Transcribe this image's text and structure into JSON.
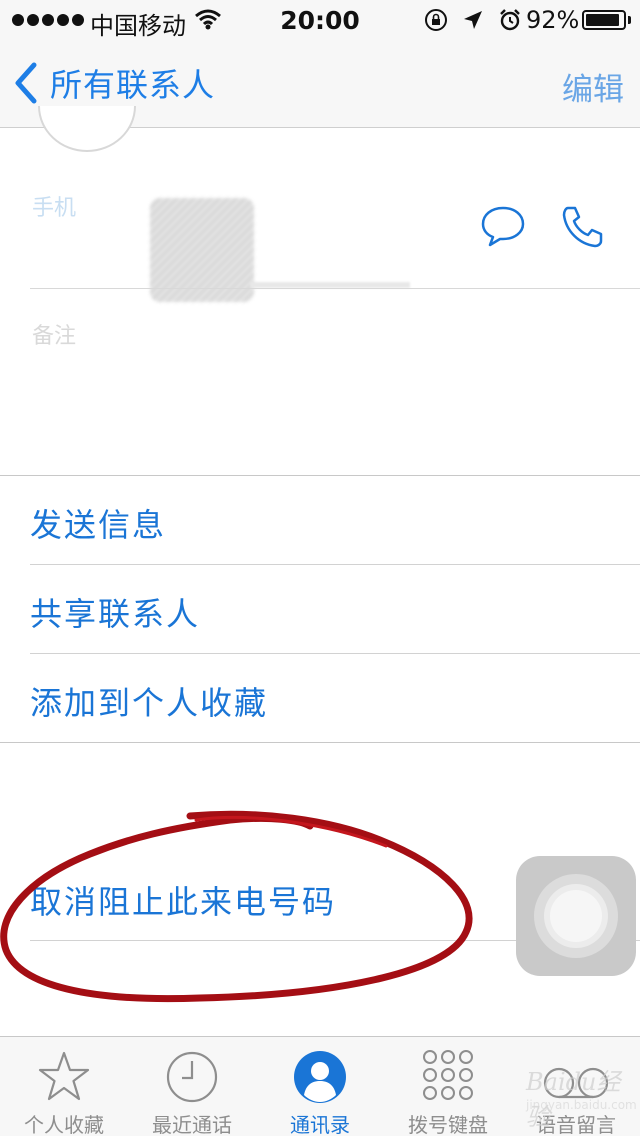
{
  "status_bar": {
    "carrier": "中国移动",
    "time": "20:00",
    "battery_percent": "92%",
    "battery_level": 0.92,
    "icons": [
      "signal-dots",
      "wifi-icon",
      "orientation-lock-icon",
      "location-icon",
      "alarm-icon",
      "battery-icon"
    ]
  },
  "nav": {
    "back_label": "所有联系人",
    "edit_label": "编辑"
  },
  "contact": {
    "mobile_label": "手机",
    "notes_label": "备注"
  },
  "actions": [
    {
      "label": "发送信息"
    },
    {
      "label": "共享联系人"
    },
    {
      "label": "添加到个人收藏"
    }
  ],
  "unblock": {
    "label": "取消阻止此来电号码"
  },
  "tabs": [
    {
      "label": "个人收藏",
      "icon": "star-icon",
      "active": false
    },
    {
      "label": "最近通话",
      "icon": "clock-icon",
      "active": false
    },
    {
      "label": "通讯录",
      "icon": "contacts-icon",
      "active": true
    },
    {
      "label": "拨号键盘",
      "icon": "keypad-icon",
      "active": false
    },
    {
      "label": "语音留言",
      "icon": "voicemail-icon",
      "active": false
    }
  ],
  "watermark": {
    "text": "Baidu经验",
    "sub": "jingyan.baidu.com"
  },
  "colors": {
    "accent": "#1a75d6",
    "annotation": "#a40e14"
  }
}
